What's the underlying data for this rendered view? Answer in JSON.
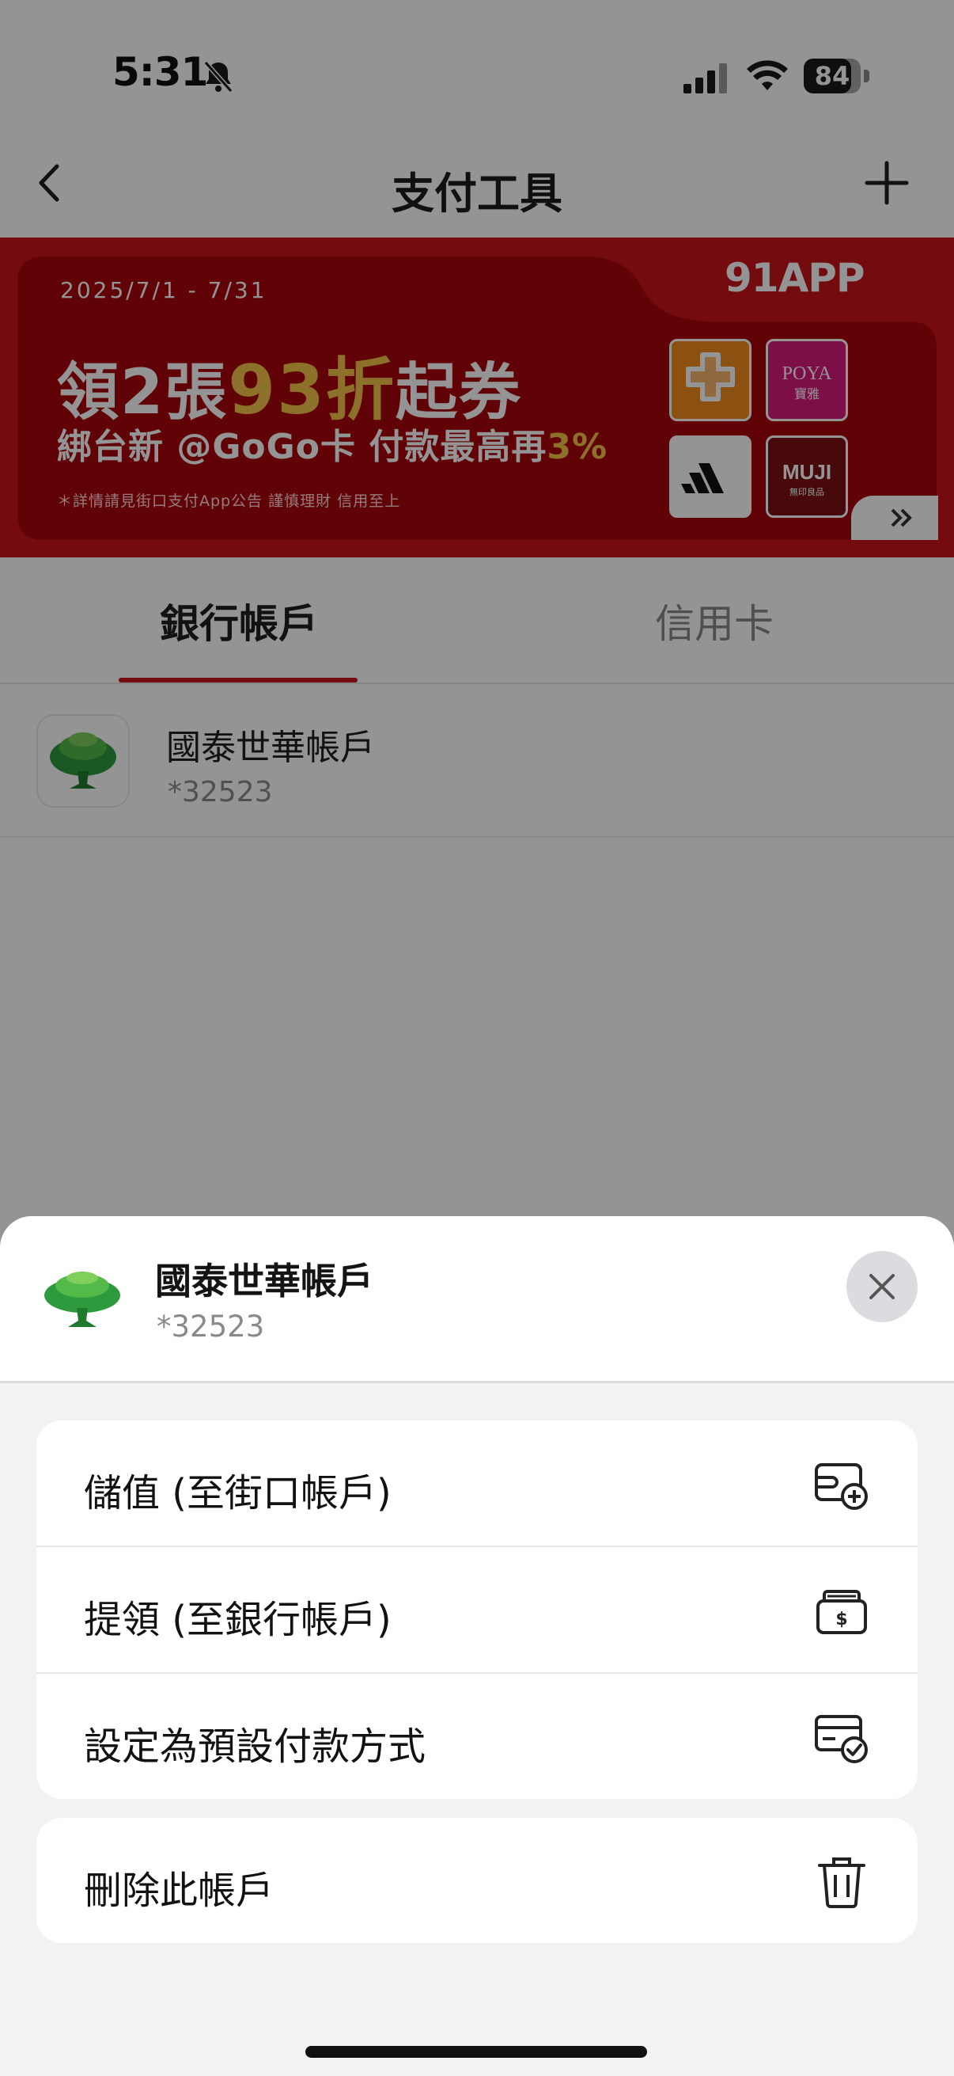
{
  "status_bar": {
    "time": "5:31",
    "battery": "84",
    "battery_level": 0.84
  },
  "nav": {
    "title": "支付工具"
  },
  "banner": {
    "date": "2025/7/1 - 7/31",
    "headline_pre": "領2張",
    "headline_highlight": "93折",
    "headline_post": "起券",
    "sub_pre": "綁台新 @GoGo卡 付款最高再",
    "sub_highlight": "3%",
    "note": "＊詳情請見街口支付App公告 謹慎理財 信用至上",
    "brand": "91APP",
    "logos": [
      "康是美網購",
      "POYA 寶雅",
      "adidas",
      "MUJI 無印良品"
    ]
  },
  "tabs": [
    {
      "label": "銀行帳戶",
      "active": true
    },
    {
      "label": "信用卡",
      "active": false
    }
  ],
  "account": {
    "name": "國泰世華帳戶",
    "number": "*32523"
  },
  "sheet": {
    "name": "國泰世華帳戶",
    "number": "*32523",
    "menu": [
      {
        "label": "儲值 (至街口帳戶)",
        "icon": "wallet-add-icon"
      },
      {
        "label": "提領 (至銀行帳戶)",
        "icon": "cash-withdraw-icon"
      },
      {
        "label": "設定為預設付款方式",
        "icon": "card-check-icon"
      }
    ],
    "danger_menu": [
      {
        "label": "刪除此帳戶",
        "icon": "trash-icon"
      }
    ]
  },
  "colors": {
    "brand_red": "#c8141b",
    "highlight_gold": "#f3c34a",
    "bank_green": "#2e9a3e"
  }
}
